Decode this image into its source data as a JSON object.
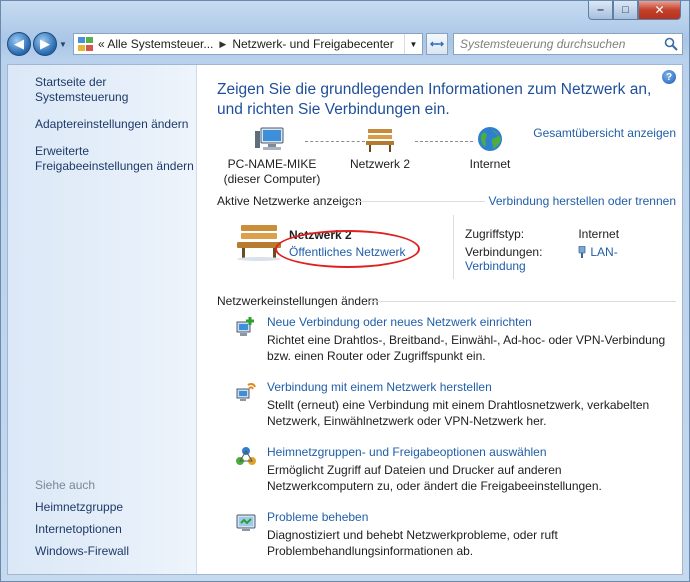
{
  "window": {
    "controls": {
      "minimize": "‒",
      "maximize": "□",
      "close": "✕"
    }
  },
  "toolbar": {
    "back": "◀",
    "forward": "▶",
    "address_crumbs": [
      "« Alle Systemsteuer...",
      "Netzwerk- und Freigabecenter"
    ],
    "search_placeholder": "Systemsteuerung durchsuchen"
  },
  "sidebar": {
    "top_links": [
      "Startseite der Systemsteuerung",
      "Adaptereinstellungen ändern",
      "Erweiterte Freigabeeinstellungen ändern"
    ],
    "see_also_label": "Siehe auch",
    "see_also_links": [
      "Heimnetzgruppe",
      "Internetoptionen",
      "Windows-Firewall"
    ]
  },
  "main": {
    "title": "Zeigen Sie die grundlegenden Informationen zum Netzwerk an, und richten Sie Verbindungen ein.",
    "overview_link": "Gesamtübersicht anzeigen",
    "map": {
      "computer_line1": "PC-NAME-MIKE",
      "computer_line2": "(dieser Computer)",
      "network": "Netzwerk  2",
      "internet": "Internet"
    },
    "active_networks_label": "Aktive Netzwerke anzeigen",
    "connect_link": "Verbindung herstellen oder trennen",
    "network": {
      "name": "Netzwerk  2",
      "type_link": "Öffentliches Netzwerk",
      "access_label": "Zugriffstyp:",
      "access_value": "Internet",
      "connections_label": "Verbindungen:",
      "connections_value": "LAN-Verbindung"
    },
    "settings_label": "Netzwerkeinstellungen ändern",
    "tasks": [
      {
        "icon": "new-connection-icon",
        "title": "Neue Verbindung oder neues Netzwerk einrichten",
        "desc": "Richtet eine Drahtlos-, Breitband-, Einwähl-, Ad-hoc- oder VPN-Verbindung bzw. einen Router oder Zugriffspunkt ein."
      },
      {
        "icon": "connect-network-icon",
        "title": "Verbindung mit einem Netzwerk herstellen",
        "desc": "Stellt (erneut) eine Verbindung mit einem Drahtlosnetzwerk, verkabelten Netzwerk, Einwählnetzwerk oder VPN-Netzwerk her."
      },
      {
        "icon": "homegroup-icon",
        "title": "Heimnetzgruppen- und Freigabeoptionen auswählen",
        "desc": "Ermöglicht Zugriff auf Dateien und Drucker auf anderen Netzwerkcomputern zu, oder ändert die Freigabeeinstellungen."
      },
      {
        "icon": "troubleshoot-icon",
        "title": "Probleme beheben",
        "desc": "Diagnostiziert und behebt Netzwerkprobleme, oder ruft Problembehandlungsinformationen ab."
      }
    ]
  }
}
